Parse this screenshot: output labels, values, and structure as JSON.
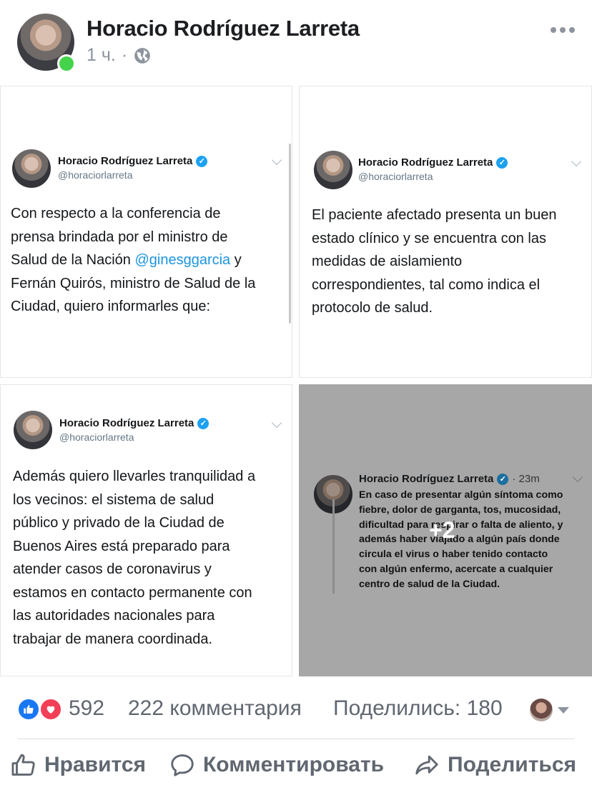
{
  "post": {
    "author": "Horacio Rodríguez Larreta",
    "time": "1 ч.",
    "separator": "·"
  },
  "tweets": [
    {
      "name": "Horacio Rodríguez Larreta",
      "handle": "@horaciorlarreta",
      "lines": [
        "Con respecto a la conferencia de",
        "prensa brindada por el ministro de",
        "Salud de la Nación ",
        "@ginesggarcia",
        " y",
        "Fernán Quirós, ministro de Salud de la",
        "Ciudad, quiero informarles que:"
      ]
    },
    {
      "name": "Horacio Rodríguez Larreta",
      "handle": "@horaciorlarreta",
      "lines": [
        "El paciente afectado presenta un buen",
        "estado clínico y se encuentra con las",
        "medidas de aislamiento",
        "correspondientes, tal como indica el",
        "protocolo de salud."
      ]
    },
    {
      "name": "Horacio Rodríguez Larreta",
      "handle": "@horaciorlarreta",
      "lines": [
        "Además quiero llevarles tranquilidad a",
        "los vecinos: el sistema de salud",
        "público y privado de la Ciudad de",
        "Buenos Aires está preparado para",
        "atender casos de coronavirus y",
        "estamos en contacto permanente con",
        "las autoridades nacionales para",
        "trabajar de manera coordinada."
      ]
    },
    {
      "name": "Horacio Rodríguez Larreta",
      "time": "· 23m",
      "lines": [
        "En caso de presentar algún síntoma como",
        "fiebre, dolor de garganta, tos, mucosidad,",
        "dificultad para respirar o falta de aliento, y",
        "además haber viajado a algún país donde",
        "circula el virus o haber tenido contacto",
        "con algún enfermo, acercate a cualquier",
        "centro de salud de la Ciudad."
      ],
      "more_count": "+2"
    }
  ],
  "reactions": {
    "count": "592",
    "comments": "222 комментария",
    "shares": "Поделились: 180"
  },
  "actions": {
    "like": "Нравится",
    "comment": "Комментировать",
    "share": "Поделиться"
  },
  "colors": {
    "like_blue": "#1877f2",
    "love_red": "#f33e58",
    "verified_blue": "#1da1f2",
    "mention_blue": "#1b95e0",
    "online_green": "#44d34a"
  }
}
